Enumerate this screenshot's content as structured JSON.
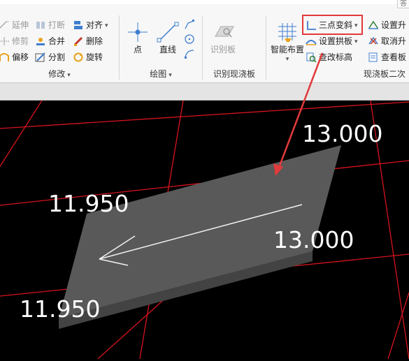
{
  "colors": {
    "ribbon_bg": "#f7f7f7",
    "canvas_bg": "#000000",
    "grid_line": "#d6141c",
    "slab_top": "#595959",
    "slab_edge": "#434343",
    "highlight": "#e23a3a",
    "arrow": "#e23a3a",
    "text": "#ffffff"
  },
  "ribbon": {
    "corner_tab": "答",
    "modify": {
      "items": [
        {
          "label": "延伸",
          "icon": "extend-icon",
          "enabled": false
        },
        {
          "label": "打断",
          "icon": "break-icon",
          "enabled": false
        },
        {
          "label": "对齐",
          "icon": "align-icon",
          "enabled": true,
          "has_dropdown": true
        },
        {
          "label": "修剪",
          "icon": "trim-icon",
          "enabled": false
        },
        {
          "label": "合并",
          "icon": "merge-icon",
          "enabled": true
        },
        {
          "label": "删除",
          "icon": "delete-icon",
          "enabled": true
        },
        {
          "label": "偏移",
          "icon": "offset-icon",
          "enabled": true
        },
        {
          "label": "分割",
          "icon": "split-icon",
          "enabled": true
        },
        {
          "label": "旋转",
          "icon": "rotate-icon",
          "enabled": true
        }
      ],
      "group_label": "修改"
    },
    "draw": {
      "point_label": "点",
      "line_label": "直线",
      "group_label": "绘图"
    },
    "identify": {
      "button_label": "识别板",
      "group_label": "识别现浇板"
    },
    "slab2": {
      "smart_layout_label": "智能布置",
      "three_point_slope_label": "三点变斜",
      "set_arch_label": "设置拱板",
      "check_elevation_label": "查改标高",
      "set_raise_label": "设置升",
      "cancel_raise_label": "取消升",
      "view_slab_label": "查看板",
      "group_label": "现浇板二次"
    }
  },
  "canvas": {
    "elevations": {
      "top_right": "13.000",
      "mid_right": "13.000",
      "top_left": "11.950",
      "bottom_left": "11.950"
    }
  }
}
